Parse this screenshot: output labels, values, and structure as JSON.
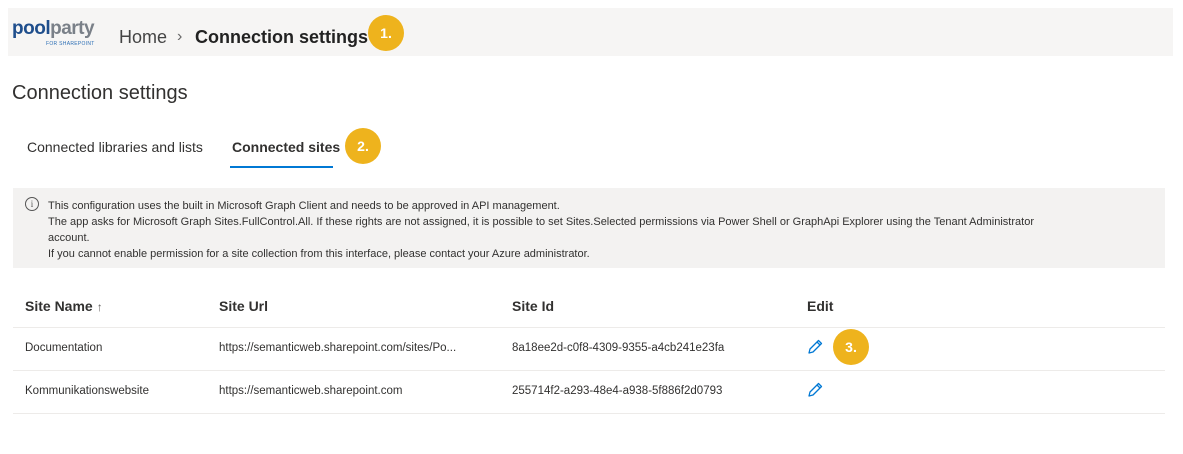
{
  "header": {
    "logo_text_pool": "pool",
    "logo_text_party": "party",
    "logo_subtext": "FOR SHAREPOINT",
    "breadcrumb": {
      "home": "Home",
      "separator": "›",
      "current": "Connection settings"
    },
    "badge": "1."
  },
  "page": {
    "title": "Connection settings"
  },
  "tabs": {
    "items": [
      {
        "label": "Connected libraries and lists",
        "active": false
      },
      {
        "label": "Connected sites",
        "active": true
      }
    ],
    "badge": "2."
  },
  "info_box": {
    "icon": "info-icon",
    "lines": [
      "This configuration uses the built in Microsoft Graph Client and needs to be approved in API management.",
      "The app asks for Microsoft Graph Sites.FullControl.All. If these rights are not assigned, it is possible to set Sites.Selected permissions via Power Shell or GraphApi Explorer using the Tenant Administrator",
      "account.",
      "If you cannot enable permission for a site collection from this interface, please contact your Azure administrator."
    ]
  },
  "table": {
    "columns": {
      "site_name": "Site Name",
      "site_url": "Site Url",
      "site_id": "Site Id",
      "edit": "Edit"
    },
    "sort_indicator": "↑",
    "rows": [
      {
        "site_name": "Documentation",
        "site_url": "https://semanticweb.sharepoint.com/sites/Po...",
        "site_id": "8a18ee2d-c0f8-4309-9355-a4cb241e23fa",
        "edit_icon": "pencil-icon"
      },
      {
        "site_name": "Kommunikationswebsite",
        "site_url": "https://semanticweb.sharepoint.com",
        "site_id": "255714f2-a293-48e4-a938-5f886f2d0793",
        "edit_icon": "pencil-icon"
      }
    ],
    "badge": "3."
  },
  "colors": {
    "accent": "#0078d4",
    "badge": "#eeb31d",
    "topbar": "#f6f5f4",
    "info_bg": "#f3f2f1"
  }
}
